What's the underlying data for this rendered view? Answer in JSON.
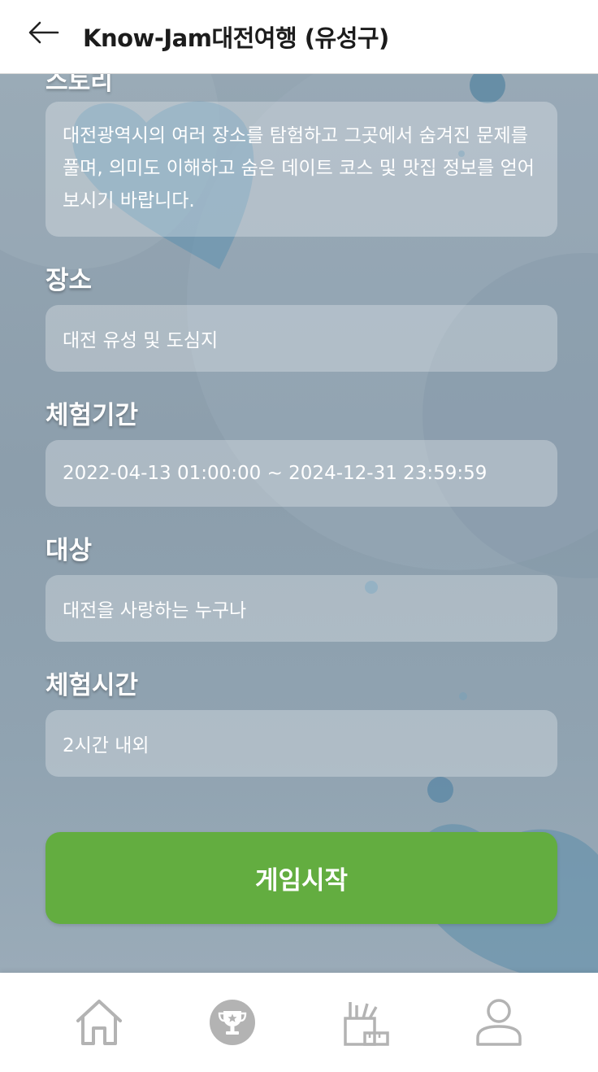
{
  "header": {
    "title": "Know-Jam대전여행 (유성구)",
    "back_icon": "arrow-left-icon"
  },
  "story": {
    "label_partial": "스토리",
    "text": "대전광역시의 여러 장소를 탐험하고 그곳에서 숨겨진 문제를 풀며, 의미도 이해하고 숨은 데이트 코스 및 맛집 정보를 얻어 보시기 바랍니다."
  },
  "place": {
    "label": "장소",
    "value": "대전 유성 및 도심지"
  },
  "period": {
    "label": "체험기간",
    "value": "2022-04-13 01:00:00 ~ 2024-12-31 23:59:59"
  },
  "target": {
    "label": "대상",
    "value": "대전을 사랑하는 누구나"
  },
  "duration": {
    "label": "체험시간",
    "value": "2시간 내외"
  },
  "start_button": {
    "label": "게임시작"
  },
  "bottom_nav": {
    "items": [
      {
        "icon": "home-icon"
      },
      {
        "icon": "trophy-icon"
      },
      {
        "icon": "pencil-cup-icon"
      },
      {
        "icon": "user-icon"
      }
    ]
  },
  "colors": {
    "accent_green": "#63ad40",
    "background": "#8fa1b0",
    "nav_icon": "#b3b3b3"
  }
}
